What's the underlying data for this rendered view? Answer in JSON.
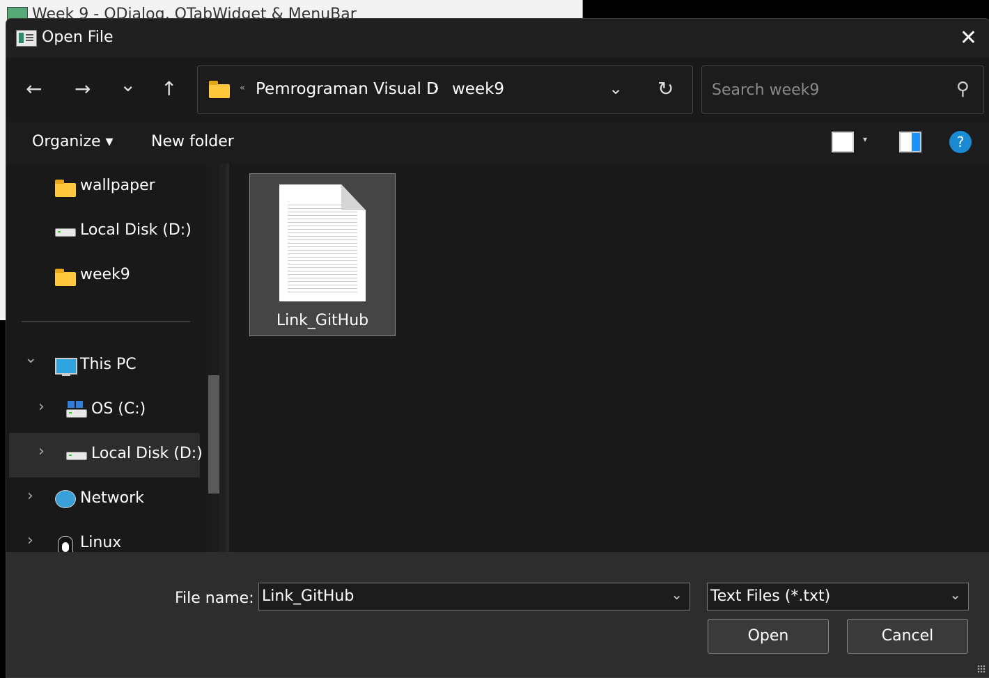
{
  "background_window": {
    "title": "Week 9 - QDialog, QTabWidget & MenuBar"
  },
  "dialog": {
    "title": "Open File",
    "close_icon": "close-icon"
  },
  "nav": {
    "back_icon": "←",
    "forward_icon": "→",
    "recent_icon": "⌄",
    "up_icon": "↑",
    "address": {
      "overflow": "«",
      "crumbs": [
        "Pemrograman Visual D",
        "week9"
      ],
      "separator": "›",
      "dropdown_icon": "⌄",
      "refresh_icon": "↻"
    },
    "search": {
      "placeholder": "Search week9",
      "icon": "⚲"
    }
  },
  "toolbar": {
    "organize": "Organize ▾",
    "new_folder": "New folder",
    "view_dropdown": "▾",
    "help": "?"
  },
  "sidebar": {
    "items": [
      {
        "label": "wallpaper",
        "icon": "folder-icon"
      },
      {
        "label": "Local Disk (D:)",
        "icon": "drive-icon"
      },
      {
        "label": "week9",
        "icon": "folder-icon"
      },
      {
        "label": "This PC",
        "icon": "computer-icon",
        "expanded": true
      },
      {
        "label": "OS (C:)",
        "icon": "windows-drive-icon"
      },
      {
        "label": "Local Disk (D:)",
        "icon": "drive-icon",
        "selected": true
      },
      {
        "label": "Network",
        "icon": "network-icon"
      },
      {
        "label": "Linux",
        "icon": "linux-icon"
      }
    ],
    "chevron_expanded": "⌄",
    "chevron_collapsed": "›"
  },
  "files": [
    {
      "name": "Link_GitHub",
      "icon": "text-document-icon",
      "selected": true
    }
  ],
  "bottom": {
    "filename_label": "File name:",
    "filename_value": "Link_GitHub",
    "filter_value": "Text Files (*.txt)",
    "combo_arrow": "⌄",
    "open_button": "Open",
    "cancel_button": "Cancel"
  }
}
